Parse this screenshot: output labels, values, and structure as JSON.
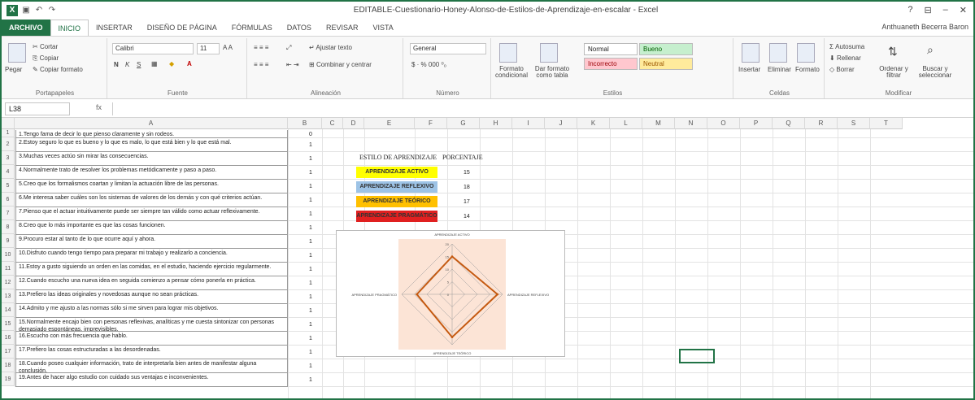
{
  "window": {
    "title": "EDITABLE-Cuestionario-Honey-Alonso-de-Estilos-de-Aprendizaje-en-escalar - Excel",
    "controls": [
      "?",
      "⊟",
      "–",
      "✕"
    ],
    "user": "Anthuaneth Becerra Baron"
  },
  "tabs": [
    "ARCHIVO",
    "INICIO",
    "INSERTAR",
    "DISEÑO DE PÁGINA",
    "FÓRMULAS",
    "DATOS",
    "REVISAR",
    "VISTA"
  ],
  "ribbon": {
    "clipboard": {
      "paste": "Pegar",
      "cut": "Cortar",
      "copy": "Copiar",
      "format_painter": "Copiar formato",
      "label": "Portapapeles"
    },
    "font": {
      "name": "Calibri",
      "size": "11",
      "label": "Fuente"
    },
    "alignment": {
      "wrap": "Ajustar texto",
      "merge": "Combinar y centrar",
      "label": "Alineación"
    },
    "number": {
      "format": "General",
      "label": "Número"
    },
    "styles": {
      "conditional": "Formato condicional",
      "table": "Dar formato como tabla",
      "normal": "Normal",
      "bueno": "Bueno",
      "incorrecto": "Incorrecto",
      "neutral": "Neutral",
      "label": "Estilos"
    },
    "cells": {
      "insert": "Insertar",
      "delete": "Eliminar",
      "format": "Formato",
      "label": "Celdas"
    },
    "editing": {
      "autosum": "Autosuma",
      "fill": "Rellenar",
      "clear": "Borrar",
      "sort": "Ordenar y filtrar",
      "find": "Buscar y seleccionar",
      "label": "Modificar"
    }
  },
  "formula_bar": {
    "name_box": "L38",
    "fx": "fx",
    "value": ""
  },
  "columns": [
    "A",
    "B",
    "C",
    "D",
    "E",
    "F",
    "G",
    "H",
    "I",
    "J",
    "K",
    "L",
    "M",
    "N",
    "O",
    "P",
    "Q",
    "R",
    "S",
    "T"
  ],
  "rows": [
    "1",
    "2",
    "3",
    "4",
    "5",
    "6",
    "7",
    "8",
    "9",
    "10",
    "11",
    "12",
    "13",
    "14",
    "15",
    "16",
    "17",
    "18",
    "19"
  ],
  "questions": [
    "1.Tengo fama de decir lo que pienso claramente y sin rodeos.",
    "2.Estoy seguro lo que es bueno y lo que es malo, lo que está bien y lo que está mal.",
    "3.Muchas veces actúo sin mirar las consecuencias.",
    "4.Normalmente trato de resolver los problemas metódicamente y paso a paso.",
    "5.Creo que los formalismos coartan y limitan la actuación libre de las personas.",
    "6.Me interesa saber cuáles son los sistemas de valores de los demás y con qué criterios actúan.",
    "7.Pienso que el actuar intuitivamente puede ser siempre tan válido como actuar reflexivamente.",
    "8.Creo que lo más importante es que las cosas funcionen.",
    "9.Procuro estar al tanto de lo que ocurre aquí y ahora.",
    "10.Disfruto cuando tengo tiempo para preparar mi trabajo y realizarlo a conciencia.",
    "11.Estoy a gusto siguiendo un orden en las comidas, en el estudio, haciendo ejercicio regularmente.",
    "12.Cuando escucho una nueva idea en seguida comienzo a pensar cómo ponerla en práctica.",
    "13.Prefiero las ideas originales y novedosas aunque no sean prácticas.",
    "14.Admito y me ajusto a las normas sólo si me sirven para lograr mis objetivos.",
    "15.Normalmente encajo bien con personas reflexivas, analíticas y me cuesta sintonizar con personas demasiado espontáneas, imprevisibles.",
    "16.Escucho con más frecuencia que hablo.",
    "17.Prefiero las cosas estructuradas a las desordenadas.",
    "18.Cuando poseo cualquier información, trato de interpretarla bien antes de manifestar alguna conclusión.",
    "19.Antes de hacer algo estudio con cuidado sus ventajas e inconvenientes."
  ],
  "b_values": [
    "0",
    "1",
    "1",
    "1",
    "1",
    "1",
    "1",
    "1",
    "1",
    "1",
    "1",
    "1",
    "1",
    "1",
    "1",
    "1",
    "1",
    "1",
    "1"
  ],
  "results": {
    "header_style": "ESTILO DE APRENDIZAJE",
    "header_pct": "PORCENTAJE",
    "items": [
      {
        "label": "APRENDIZAJE ACTIVO",
        "value": "15",
        "color": "#ffff00"
      },
      {
        "label": "APRENDIZAJE REFLEXIVO",
        "value": "18",
        "color": "#9dc3e6"
      },
      {
        "label": "APRENDIZAJE TEÓRICO",
        "value": "17",
        "color": "#ffc000"
      },
      {
        "label": "APRENDIZAJE PRAGMÁTICO",
        "value": "14",
        "color": "#e02020"
      }
    ]
  },
  "chart_data": {
    "type": "radar",
    "categories": [
      "APRENDIZAJE ACTIVO",
      "APRENDIZAJE REFLEXIVO",
      "APRENDIZAJE TEÓRICO",
      "APRENDIZAJE PRAGMÁTICO"
    ],
    "series": [
      {
        "values": [
          15,
          18,
          17,
          14
        ]
      }
    ],
    "rmax": 20,
    "ticks": [
      "0",
      "5",
      "10",
      "15",
      "20"
    ],
    "line_color": "#c55a11",
    "background": "#fce4d6"
  }
}
